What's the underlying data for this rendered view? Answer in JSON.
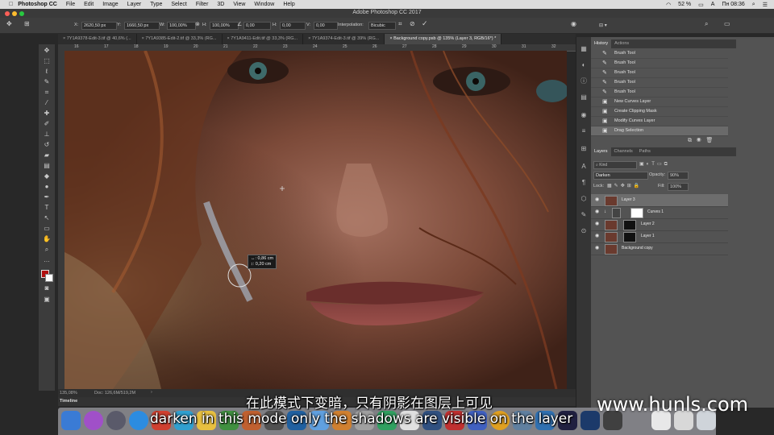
{
  "menubar": {
    "app": "Photoshop CC",
    "items": [
      "File",
      "Edit",
      "Image",
      "Layer",
      "Type",
      "Select",
      "Filter",
      "3D",
      "View",
      "Window",
      "Help"
    ],
    "battery": "52 %",
    "input_lang": "A",
    "clock": "Пн 08:36"
  },
  "window": {
    "title": "Adobe Photoshop CC 2017"
  },
  "options": {
    "x_label": "X:",
    "x_value": "2620,50 px",
    "y_label": "Y:",
    "y_value": "1660,50 px",
    "w_label": "W:",
    "w_value": "100,00%",
    "h_label": "H:",
    "h_value": "100,00%",
    "angle_value": "0,00",
    "hskew_label": "H:",
    "hskew_value": "0,00",
    "vskew_label": "V:",
    "vskew_value": "0,00",
    "interp_label": "Interpolation:",
    "interp_value": "Bicubic"
  },
  "tabs": [
    {
      "label": "7Y1A9378-Edit-3.tif @ 40,6% (...",
      "active": false
    },
    {
      "label": "7Y1A9385-Edit-2.tif @ 33,3% (RG...",
      "active": false
    },
    {
      "label": "7Y1A9411-Edit.tif @ 33,3% (RG...",
      "active": false
    },
    {
      "label": "7Y1A9374-Edit-3.tif @ 39% (RG...",
      "active": false
    },
    {
      "label": "Background copy.psb @ 135% (Layer 3, RGB/16*) *",
      "active": true
    }
  ],
  "ruler": {
    "marks": [
      "16",
      "17",
      "18",
      "19",
      "20",
      "21",
      "22",
      "23",
      "24",
      "25",
      "26",
      "27",
      "28",
      "29",
      "30",
      "31",
      "32"
    ]
  },
  "tooltip": {
    "line1": "↔: 0,86 cm",
    "line2": "↕: 0,20 cm"
  },
  "status": {
    "zoom": "135,08%",
    "doc": "Doc: 126,6M/519,2M"
  },
  "timeline": {
    "label": "Timeline"
  },
  "history": {
    "tabs": [
      "History",
      "Actions"
    ],
    "items": [
      {
        "label": "Brush Tool",
        "icon": "brush-icon"
      },
      {
        "label": "Brush Tool",
        "icon": "brush-icon"
      },
      {
        "label": "Brush Tool",
        "icon": "brush-icon"
      },
      {
        "label": "Brush Tool",
        "icon": "brush-icon"
      },
      {
        "label": "Brush Tool",
        "icon": "brush-icon"
      },
      {
        "label": "New Curves Layer",
        "icon": "curves-icon"
      },
      {
        "label": "Create Clipping Mask",
        "icon": "curves-icon"
      },
      {
        "label": "Modify Curves Layer",
        "icon": "curves-icon"
      },
      {
        "label": "Drag Selection",
        "icon": "selection-icon"
      }
    ]
  },
  "layers": {
    "tabs": [
      "Layers",
      "Channels",
      "Paths"
    ],
    "kind": "Kind",
    "blend": "Darken",
    "opacity_label": "Opacity:",
    "opacity": "90%",
    "lock_label": "Lock:",
    "fill_label": "Fill:",
    "fill": "100%",
    "rows": [
      {
        "name": "Layer 3",
        "selected": true
      },
      {
        "name": "Curves 1",
        "selected": false
      },
      {
        "name": "Layer 2",
        "selected": false
      },
      {
        "name": "Layer 1",
        "selected": false
      },
      {
        "name": "Background copy",
        "selected": false
      }
    ]
  },
  "subtitles": {
    "zh": "在此模式下变暗，只有阴影在图层上可见",
    "en": "darken in this mode only the shadows are visible on the layer"
  },
  "watermark": "www.hunls.com"
}
